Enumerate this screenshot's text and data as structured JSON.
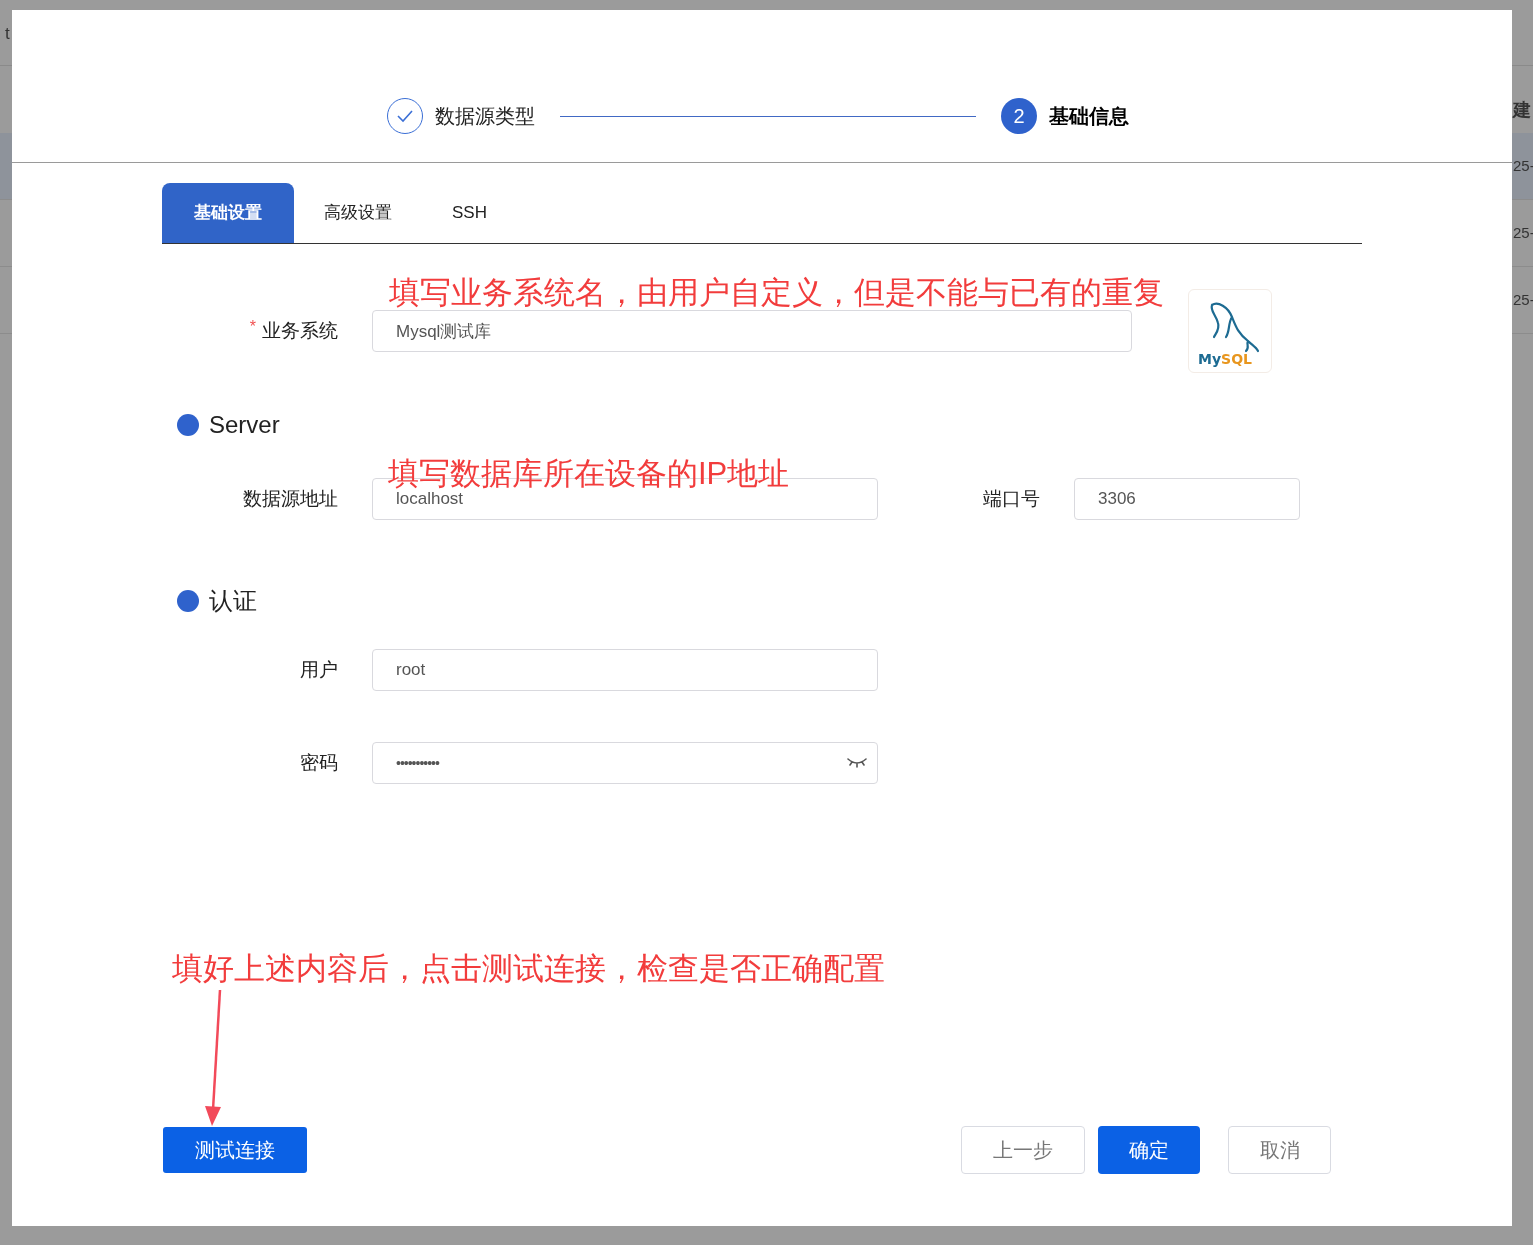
{
  "background_page": {
    "header_left": "t",
    "header_right": "建",
    "rows": [
      {
        "cell": "25-",
        "selected": true
      },
      {
        "cell": "25-",
        "selected": false
      },
      {
        "cell": "25-",
        "selected": false
      }
    ]
  },
  "steps": [
    {
      "label": "数据源类型",
      "completed": true
    },
    {
      "number": "2",
      "label": "基础信息",
      "completed": false
    }
  ],
  "tabs": [
    {
      "label": "基础设置",
      "selected": true
    },
    {
      "label": "高级设置",
      "selected": false
    },
    {
      "label": "SSH",
      "selected": false
    }
  ],
  "business_system": {
    "label": "业务系统",
    "required_mark": "*",
    "value": "Mysql测试库"
  },
  "logo_text": {
    "part1": "My",
    "part2": "SQL"
  },
  "server": {
    "heading": "Server",
    "address_label": "数据源地址",
    "address_value": "localhost",
    "port_label": "端口号",
    "port_value": "3306"
  },
  "auth": {
    "heading": "认证",
    "user_label": "用户",
    "user_value": "root",
    "password_label": "密码",
    "password_value": "•••••••••••"
  },
  "annotations": [
    "填写业务系统名，由用户自定义，但是不能与已有的重复",
    "填写数据库所在设备的IP地址",
    "填好上述内容后，点击测试连接，检查是否正确配置"
  ],
  "buttons": {
    "test": "测试连接",
    "prev": "上一步",
    "ok": "确定",
    "cancel": "取消"
  }
}
